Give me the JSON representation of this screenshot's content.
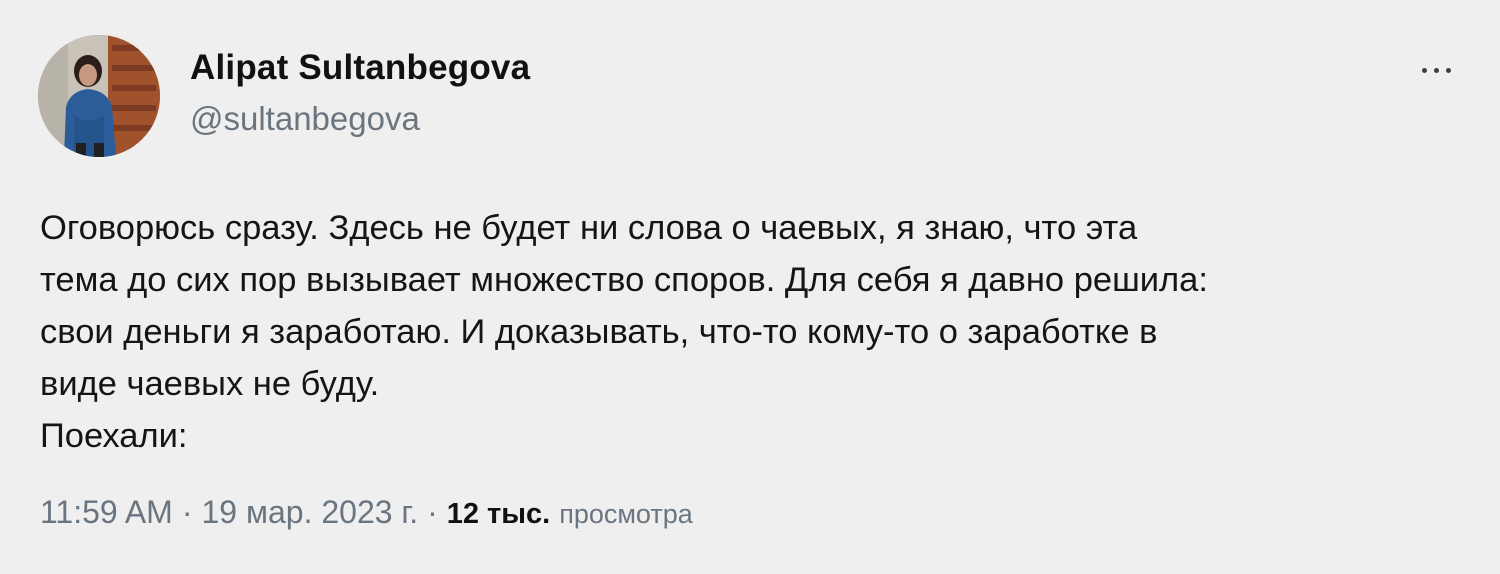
{
  "author": {
    "display_name": "Alipat Sultanbegova",
    "handle": "@sultanbegova",
    "avatar_icon": "profile-photo"
  },
  "more_icon": "more-horizontal-icon",
  "tweet": {
    "lines": [
      "Оговорюсь сразу. Здесь не будет ни слова о чаевых, я знаю, что эта",
      "тема до сих пор вызывает множество споров. Для себя я давно решила:",
      "свои деньги я заработаю. И доказывать, что-то кому-то о заработке в",
      "виде чаевых не буду.",
      "Поехали:"
    ]
  },
  "meta": {
    "time": "11:59 AM",
    "date": "19 мар. 2023 г.",
    "separator": "·",
    "views_count": "12 тыс.",
    "views_label": "просмотра"
  }
}
